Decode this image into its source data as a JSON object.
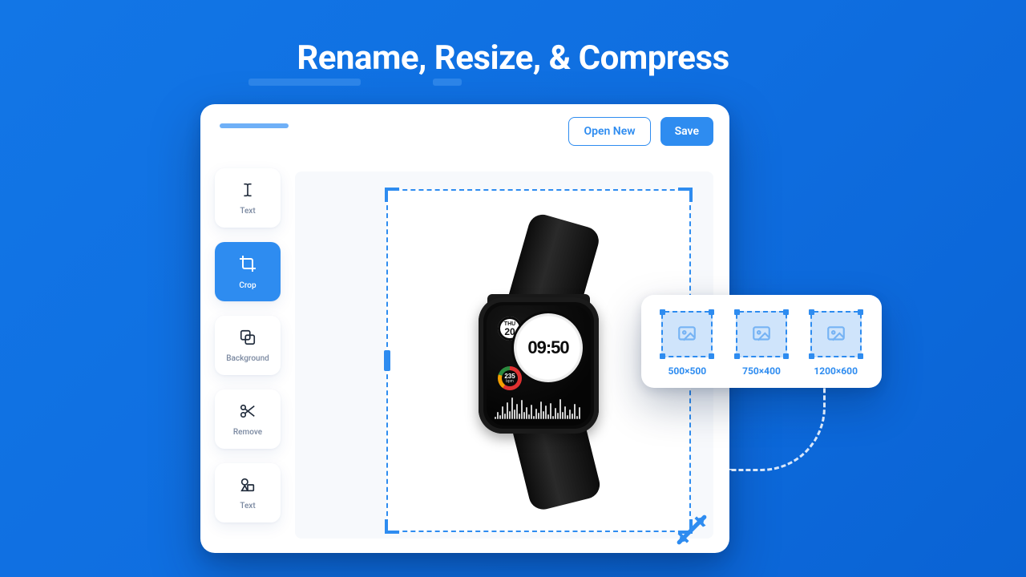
{
  "hero": {
    "title": "Rename, Resize, & Compress"
  },
  "topbar": {
    "open_label": "Open New",
    "save_label": "Save"
  },
  "tools": [
    {
      "id": "text",
      "label": "Text",
      "icon": "text-cursor-icon",
      "active": false
    },
    {
      "id": "crop",
      "label": "Crop",
      "icon": "crop-icon",
      "active": true
    },
    {
      "id": "background",
      "label": "Background",
      "icon": "layers-icon",
      "active": false
    },
    {
      "id": "remove",
      "label": "Remove",
      "icon": "scissors-icon",
      "active": false
    },
    {
      "id": "text2",
      "label": "Text",
      "icon": "shapes-icon",
      "active": false
    }
  ],
  "product_watch": {
    "day_label": "THU",
    "day_number": "20",
    "time": "09:50",
    "heart_rate": "235",
    "heart_rate_unit": "bpm"
  },
  "size_presets": [
    {
      "label": "500×500"
    },
    {
      "label": "750×400"
    },
    {
      "label": "1200×600"
    }
  ]
}
